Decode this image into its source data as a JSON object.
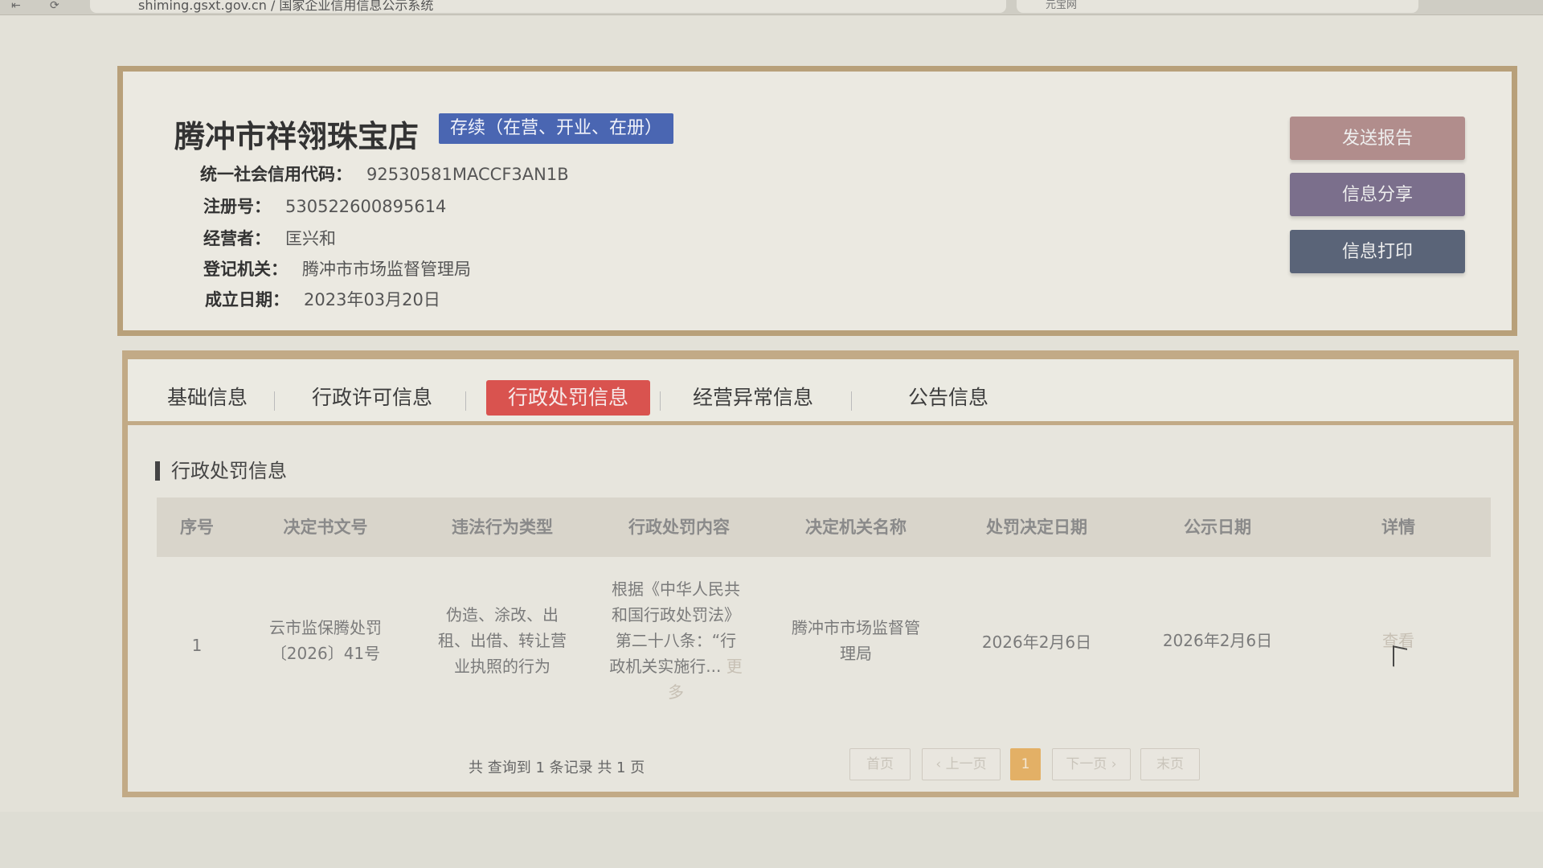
{
  "browser": {
    "url": "shiming.gsxt.gov.cn / 国家企业信用信息公示系统",
    "search_placeholder": "元宝网"
  },
  "company": {
    "name": "腾冲市祥翎珠宝店",
    "status": "存续（在营、开业、在册）",
    "fields": [
      {
        "label": "统一社会信用代码：",
        "value": "92530581MACCF3AN1B"
      },
      {
        "label": "注册号：",
        "value": "530522600895614"
      },
      {
        "label": "经营者：",
        "value": "匡兴和"
      },
      {
        "label": "登记机关：",
        "value": "腾冲市市场监督管理局"
      },
      {
        "label": "成立日期：",
        "value": "2023年03月20日"
      }
    ]
  },
  "actions": {
    "report": "发送报告",
    "share": "信息分享",
    "print": "信息打印"
  },
  "tabs": [
    {
      "label": "基础信息",
      "active": false
    },
    {
      "label": "行政许可信息",
      "active": false
    },
    {
      "label": "行政处罚信息",
      "active": true
    },
    {
      "label": "经营异常信息",
      "active": false
    },
    {
      "label": "公告信息",
      "active": false
    }
  ],
  "section": {
    "title": "行政处罚信息"
  },
  "table": {
    "headers": [
      "序号",
      "决定书文号",
      "违法行为类型",
      "行政处罚内容",
      "决定机关名称",
      "处罚决定日期",
      "公示日期",
      "详情"
    ],
    "rows": [
      {
        "index": "1",
        "doc_no_line1": "云市监保腾处罚",
        "doc_no_line2": "〔2026〕41号",
        "violation_line1": "伪造、涂改、出",
        "violation_line2": "租、出借、转让营",
        "violation_line3": "业执照的行为",
        "content_line1": "根据《中华人民共",
        "content_line2": "和国行政处罚法》",
        "content_line3": "第二十八条：“行",
        "content_line4": "政机关实施行...",
        "content_more1": "更",
        "content_more2": "多",
        "authority_line1": "腾冲市市场监督管",
        "authority_line2": "理局",
        "decision_date": "2026年2月6日",
        "publish_date": "2026年2月6日",
        "detail": "查看"
      }
    ]
  },
  "pager": {
    "summary": "共 查询到 1 条记录 共 1 页",
    "first": "首页",
    "prev": "‹ 上一页",
    "current": "1",
    "next": "下一页 ›",
    "last": "末页"
  },
  "colors": {
    "status_badge": "#4a66b2",
    "active_tab": "#d9534f",
    "report_button": "#b18d8c",
    "share_button": "#7b6f8c",
    "print_button": "#5a6478",
    "frame_border": "#b8a07a"
  }
}
